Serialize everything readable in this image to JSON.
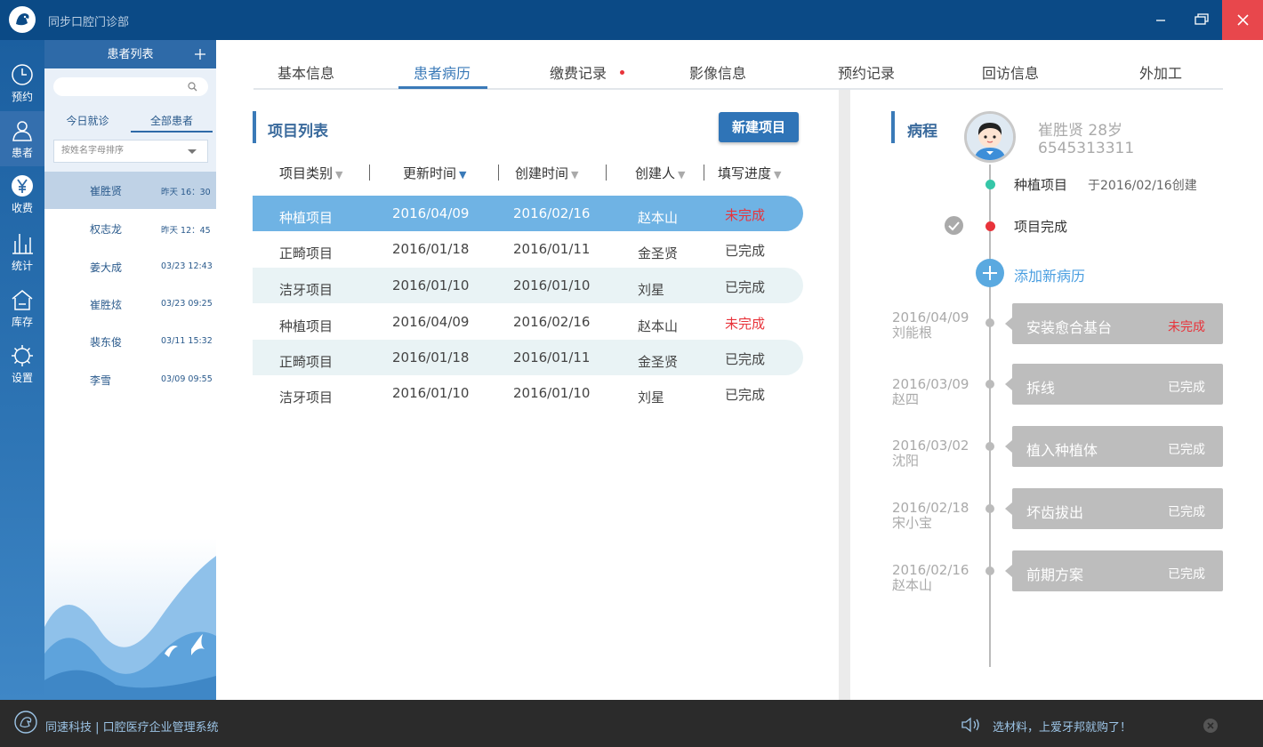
{
  "window": {
    "title": "同步口腔门诊部"
  },
  "nav": [
    {
      "label": "预约",
      "icon": "clock-icon"
    },
    {
      "label": "患者",
      "icon": "person-icon"
    },
    {
      "label": "收费",
      "icon": "yen-icon"
    },
    {
      "label": "统计",
      "icon": "bar-chart-icon"
    },
    {
      "label": "库存",
      "icon": "house-icon"
    },
    {
      "label": "设置",
      "icon": "gear-icon"
    }
  ],
  "patient_list": {
    "title": "患者列表",
    "search_placeholder": "",
    "tabs": [
      "今日就诊",
      "全部患者"
    ],
    "sort_label": "按姓名字母排序",
    "patients": [
      {
        "name": "崔胜贤",
        "time": "昨天 16：30"
      },
      {
        "name": "权志龙",
        "time": "昨天 12：45"
      },
      {
        "name": "姜大成",
        "time": "03/23 12:43"
      },
      {
        "name": "崔胜炫",
        "time": "03/23 09:25"
      },
      {
        "name": "裴东俊",
        "time": "03/11 15:32"
      },
      {
        "name": "李雪",
        "time": "03/09 09:55"
      }
    ]
  },
  "tabs": [
    "基本信息",
    "患者病历",
    "缴费记录",
    "影像信息",
    "预约记录",
    "回访信息",
    "外加工"
  ],
  "project_list": {
    "title": "项目列表",
    "new_button": "新建项目",
    "columns": [
      "项目类别",
      "更新时间",
      "创建时间",
      "创建人",
      "填写进度"
    ],
    "rows": [
      [
        "种植项目",
        "2016/04/09",
        "2016/02/16",
        "赵本山",
        "未完成"
      ],
      [
        "正畸项目",
        "2016/01/18",
        "2016/01/11",
        "金圣贤",
        "已完成"
      ],
      [
        "洁牙项目",
        "2016/01/10",
        "2016/01/10",
        "刘星",
        "已完成"
      ],
      [
        "种植项目",
        "2016/04/09",
        "2016/02/16",
        "赵本山",
        "未完成"
      ],
      [
        "正畸项目",
        "2016/01/18",
        "2016/01/11",
        "金圣贤",
        "已完成"
      ],
      [
        "洁牙项目",
        "2016/01/10",
        "2016/01/10",
        "刘星",
        "已完成"
      ]
    ]
  },
  "course": {
    "title": "病程",
    "patient_name_age": "崔胜贤   28岁",
    "patient_phone": "6545313311",
    "project_name": "种植项目",
    "project_created": "于2016/02/16创建",
    "project_complete": "项目完成",
    "add_record": "添加新病历",
    "history": [
      {
        "date": "2016/04/09",
        "doctor": "刘能根",
        "title": "安装愈合基台",
        "status": "未完成"
      },
      {
        "date": "2016/03/09",
        "doctor": "赵四",
        "title": "拆线",
        "status": "已完成"
      },
      {
        "date": "2016/03/02",
        "doctor": "沈阳",
        "title": "植入种植体",
        "status": "已完成"
      },
      {
        "date": "2016/02/18",
        "doctor": "宋小宝",
        "title": "坏齿拔出",
        "status": "已完成"
      },
      {
        "date": "2016/02/16",
        "doctor": "赵本山",
        "title": "前期方案",
        "status": "已完成"
      }
    ]
  },
  "footer": {
    "brand": "同速科技 | 口腔医疗企业管理系统",
    "notice": "选材料，上爱牙邦就购了！"
  },
  "colors": {
    "primary": "#2e6aa8",
    "accent": "#6fb3e4",
    "alert": "#e8333a"
  }
}
